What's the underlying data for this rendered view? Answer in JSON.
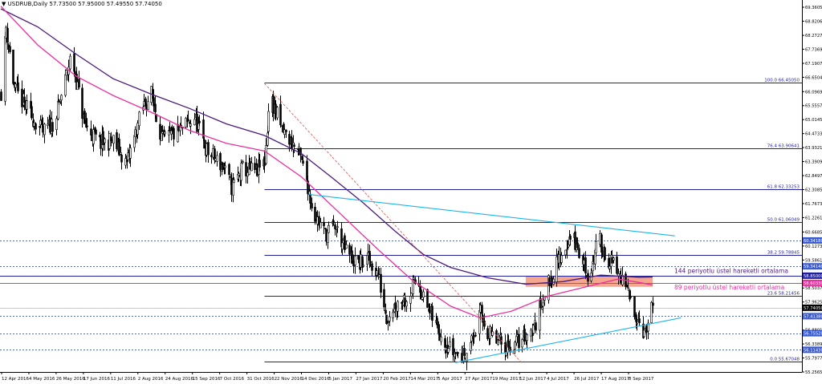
{
  "header": {
    "arrow": "▼",
    "symbol": "USDRUB,Daily",
    "ohlc": "57.73500 57.95000 57.49550 57.74050"
  },
  "colors": {
    "background": "#ffffff",
    "bull_candle": "#ffffff",
    "bear_candle": "#000000",
    "candle_wick": "#000000",
    "ema89": "#ee2ea0",
    "ema144": "#4a1a7c",
    "trendline": "#19b6ee",
    "fib_level": "#1f1f9e",
    "dotted_level": "#5a6ea8",
    "zone": "#f2967a",
    "downtrend_dashed": "#e05050",
    "price_box": "#3a5bd0"
  },
  "chart_data": {
    "type": "candlestick",
    "symbol": "USDRUB",
    "timeframe": "Daily",
    "y_ticks": [
      "69.36050",
      "68.82060",
      "68.27270",
      "67.73690",
      "67.19070",
      "66.65045",
      "66.09690",
      "65.55570",
      "65.01450",
      "64.47330",
      "63.93210",
      "63.39090",
      "62.84970",
      "62.30850",
      "61.76730",
      "61.22610",
      "60.66850",
      "60.12730",
      "59.58610",
      "59.04490",
      "58.50370",
      "57.96250",
      "57.42130",
      "56.88010",
      "56.33890",
      "55.79770",
      "55.25650"
    ],
    "ylim": [
      55.2565,
      69.3605
    ],
    "x_ticks": [
      "12 Apr 2016",
      "4 May 2016",
      "26 May 2016",
      "17 Jun 2016",
      "11 Jul 2016",
      "2 Aug 2016",
      "24 Aug 2016",
      "15 Sep 2016",
      "7 Oct 2016",
      "31 Oct 2016",
      "22 Nov 2016",
      "14 Dec 2016",
      "5 Jan 2017",
      "27 Jan 2017",
      "20 Feb 2017",
      "14 Mar 2017",
      "5 Apr 2017",
      "27 Apr 2017",
      "19 May 2017",
      "12 Jun 2017",
      "4 Jul 2017",
      "26 Jul 2017",
      "17 Aug 2017",
      "8 Sep 2017"
    ],
    "fib_levels": [
      {
        "label": "100.0  66.45050",
        "value": 66.4505
      },
      {
        "label": "76.4  63.90641",
        "value": 63.90641
      },
      {
        "label": "61.8  62.33253",
        "value": 62.33253
      },
      {
        "label": "50.0  61.06049",
        "value": 61.06049
      },
      {
        "label": "38.2  59.78845",
        "value": 59.78845
      },
      {
        "label": "23.6  58.21456",
        "value": 58.21456
      },
      {
        "label": "0.0  55.67048",
        "value": 55.67048
      }
    ],
    "dotted_levels": [
      60.3418,
      59.3414,
      57.4138,
      56.7552,
      56.1143
    ],
    "price_boxes": [
      {
        "label": "60.34180",
        "value": 60.3418,
        "color": "#3a5bd0"
      },
      {
        "label": "59.34140",
        "value": 59.3414,
        "color": "#3a5bd0"
      },
      {
        "label": "58.85000",
        "value": 58.98,
        "color": "#1f1f9e"
      },
      {
        "label": "58.60330",
        "value": 58.7,
        "color": "#ee2ea0"
      },
      {
        "label": "57.74050",
        "value": 57.7405,
        "color": "#000000"
      },
      {
        "label": "57.41380",
        "value": 57.4138,
        "color": "#3a5bd0"
      },
      {
        "label": "56.75520",
        "value": 56.7552,
        "color": "#3a5bd0"
      },
      {
        "label": "56.11430",
        "value": 56.1143,
        "color": "#3a5bd0"
      }
    ],
    "annotations": [
      {
        "text": "144 periyotlu üstel hareketli ortalama",
        "color": "#4a1a7c"
      },
      {
        "text": "89 periyotlu üstel hareketli ortalama",
        "color": "#ee2ea0"
      }
    ],
    "zone": {
      "from_date": "2017-06-01",
      "to_date": "2017-09-12",
      "low": 58.55,
      "high": 58.95
    },
    "trendlines": [
      {
        "name": "upper",
        "from": [
          "2016-12-07",
          62.12
        ],
        "to": [
          "2017-09-30",
          60.52
        ]
      },
      {
        "name": "lower",
        "from": [
          "2017-04-05",
          55.62
        ],
        "to": [
          "2017-10-05",
          57.35
        ]
      }
    ],
    "downtrend_dashed": {
      "from": [
        "2016-11-01",
        66.41
      ],
      "to": [
        "2017-05-29",
        55.6
      ]
    },
    "ema144_path": [
      [
        "2016-04-01",
        69.3
      ],
      [
        "2016-05-01",
        68.6
      ],
      [
        "2016-06-01",
        67.55
      ],
      [
        "2016-07-01",
        66.6
      ],
      [
        "2016-08-01",
        66.0
      ],
      [
        "2016-09-01",
        65.45
      ],
      [
        "2016-10-01",
        64.85
      ],
      [
        "2016-11-01",
        64.4
      ],
      [
        "2016-12-01",
        63.7
      ],
      [
        "2016-12-25",
        62.8
      ],
      [
        "2017-01-20",
        61.8
      ],
      [
        "2017-02-15",
        60.7
      ],
      [
        "2017-03-10",
        59.8
      ],
      [
        "2017-04-01",
        59.3
      ],
      [
        "2017-05-01",
        58.9
      ],
      [
        "2017-06-01",
        58.65
      ],
      [
        "2017-07-01",
        58.75
      ],
      [
        "2017-08-01",
        59.0
      ],
      [
        "2017-08-20",
        58.95
      ],
      [
        "2017-09-01",
        58.92
      ],
      [
        "2017-09-12",
        58.93
      ]
    ],
    "ema89_path": [
      [
        "2016-04-01",
        69.4
      ],
      [
        "2016-05-01",
        67.9
      ],
      [
        "2016-06-01",
        66.7
      ],
      [
        "2016-07-01",
        65.95
      ],
      [
        "2016-08-01",
        65.3
      ],
      [
        "2016-09-01",
        64.6
      ],
      [
        "2016-10-01",
        64.1
      ],
      [
        "2016-11-01",
        63.8
      ],
      [
        "2016-12-01",
        62.8
      ],
      [
        "2017-01-01",
        61.4
      ],
      [
        "2017-02-01",
        60.0
      ],
      [
        "2017-03-01",
        58.8
      ],
      [
        "2017-04-01",
        57.8
      ],
      [
        "2017-04-25",
        57.35
      ],
      [
        "2017-05-20",
        57.6
      ],
      [
        "2017-06-20",
        58.2
      ],
      [
        "2017-07-20",
        58.55
      ],
      [
        "2017-08-15",
        58.85
      ],
      [
        "2017-09-01",
        58.72
      ],
      [
        "2017-09-12",
        58.62
      ]
    ],
    "close_path": [
      [
        "2016-04-01",
        66.1
      ],
      [
        "2016-04-05",
        68.6
      ],
      [
        "2016-04-12",
        66.2
      ],
      [
        "2016-04-25",
        65.2
      ],
      [
        "2016-05-05",
        64.5
      ],
      [
        "2016-05-15",
        65.0
      ],
      [
        "2016-05-28",
        67.5
      ],
      [
        "2016-06-08",
        64.8
      ],
      [
        "2016-06-20",
        64.1
      ],
      [
        "2016-07-01",
        64.2
      ],
      [
        "2016-07-12",
        63.3
      ],
      [
        "2016-07-25",
        65.5
      ],
      [
        "2016-08-01",
        66.0
      ],
      [
        "2016-08-10",
        64.2
      ],
      [
        "2016-08-25",
        64.6
      ],
      [
        "2016-09-05",
        65.1
      ],
      [
        "2016-09-15",
        63.8
      ],
      [
        "2016-09-28",
        63.2
      ],
      [
        "2016-10-05",
        62.4
      ],
      [
        "2016-10-14",
        63.1
      ],
      [
        "2016-10-25",
        63.0
      ],
      [
        "2016-11-01",
        63.4
      ],
      [
        "2016-11-05",
        66.0
      ],
      [
        "2016-11-15",
        64.6
      ],
      [
        "2016-11-28",
        63.8
      ],
      [
        "2016-12-05",
        62.7
      ],
      [
        "2016-12-10",
        61.5
      ],
      [
        "2016-12-20",
        60.6
      ],
      [
        "2016-12-28",
        60.9
      ],
      [
        "2017-01-05",
        60.0
      ],
      [
        "2017-01-15",
        59.4
      ],
      [
        "2017-01-25",
        59.6
      ],
      [
        "2017-02-01",
        59.0
      ],
      [
        "2017-02-08",
        57.4
      ],
      [
        "2017-02-15",
        57.9
      ],
      [
        "2017-02-25",
        58.2
      ],
      [
        "2017-03-05",
        58.9
      ],
      [
        "2017-03-12",
        57.8
      ],
      [
        "2017-03-22",
        56.9
      ],
      [
        "2017-04-01",
        56.1
      ],
      [
        "2017-04-10",
        55.9
      ],
      [
        "2017-04-18",
        56.4
      ],
      [
        "2017-04-25",
        57.5
      ],
      [
        "2017-05-02",
        56.7
      ],
      [
        "2017-05-12",
        56.3
      ],
      [
        "2017-05-22",
        56.3
      ],
      [
        "2017-06-01",
        56.7
      ],
      [
        "2017-06-08",
        57.0
      ],
      [
        "2017-06-15",
        58.2
      ],
      [
        "2017-06-22",
        59.0
      ],
      [
        "2017-07-01",
        59.9
      ],
      [
        "2017-07-08",
        60.6
      ],
      [
        "2017-07-15",
        59.7
      ],
      [
        "2017-07-22",
        58.9
      ],
      [
        "2017-07-30",
        60.4
      ],
      [
        "2017-08-05",
        59.7
      ],
      [
        "2017-08-12",
        59.3
      ],
      [
        "2017-08-20",
        58.6
      ],
      [
        "2017-08-26",
        57.9
      ],
      [
        "2017-09-01",
        57.2
      ],
      [
        "2017-09-06",
        56.7
      ],
      [
        "2017-09-11",
        57.74
      ]
    ]
  }
}
